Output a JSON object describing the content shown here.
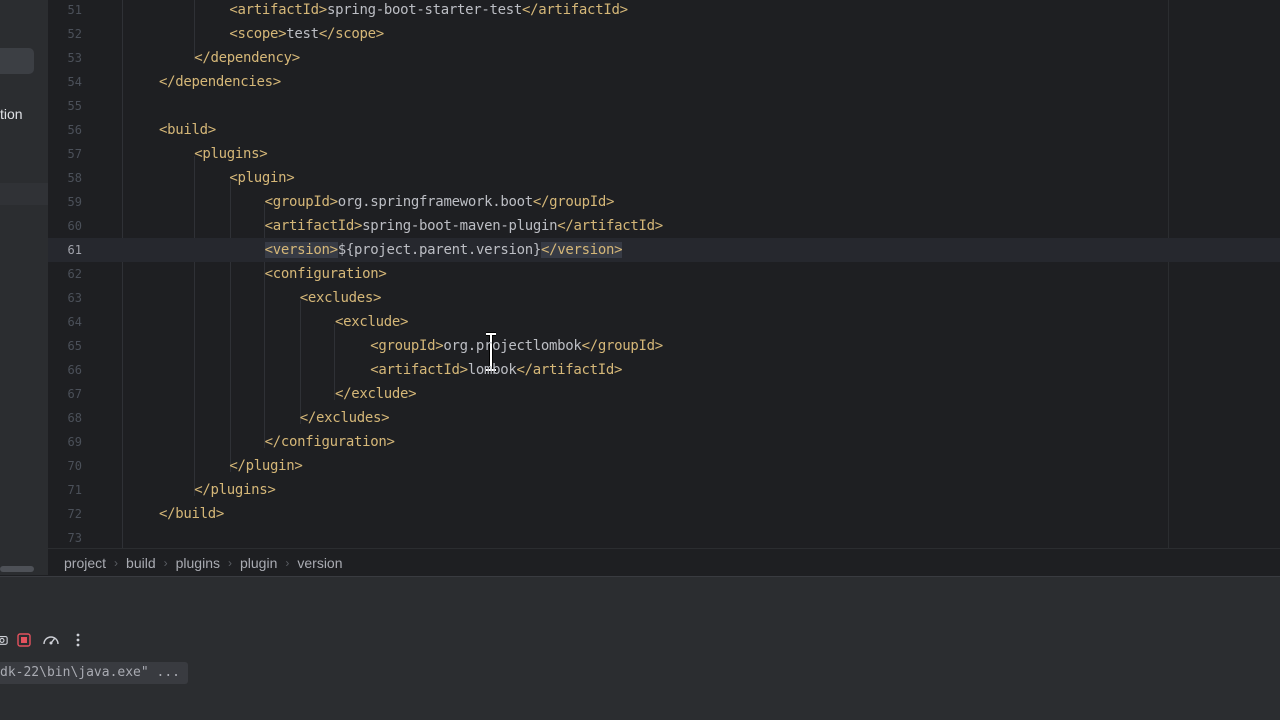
{
  "left_panel": {
    "partial_label": "tion"
  },
  "editor": {
    "lines": [
      {
        "num": "51",
        "indent": 2,
        "parts": [
          {
            "c": "tag",
            "t": "<artifactId>"
          },
          {
            "c": "txt",
            "t": "spring-boot-starter-test"
          },
          {
            "c": "tag",
            "t": "</artifactId>"
          }
        ]
      },
      {
        "num": "52",
        "indent": 2,
        "parts": [
          {
            "c": "tag",
            "t": "<scope>"
          },
          {
            "c": "txt",
            "t": "test"
          },
          {
            "c": "tag",
            "t": "</scope>"
          }
        ]
      },
      {
        "num": "53",
        "indent": 1,
        "parts": [
          {
            "c": "tag",
            "t": "</dependency>"
          }
        ]
      },
      {
        "num": "54",
        "indent": 0,
        "parts": [
          {
            "c": "tag",
            "t": "</dependencies>"
          }
        ]
      },
      {
        "num": "55",
        "indent": 0,
        "parts": []
      },
      {
        "num": "56",
        "indent": 0,
        "parts": [
          {
            "c": "tag",
            "t": "<build>"
          }
        ]
      },
      {
        "num": "57",
        "indent": 1,
        "parts": [
          {
            "c": "tag",
            "t": "<plugins>"
          }
        ]
      },
      {
        "num": "58",
        "indent": 2,
        "parts": [
          {
            "c": "tag",
            "t": "<plugin>"
          }
        ]
      },
      {
        "num": "59",
        "indent": 3,
        "parts": [
          {
            "c": "tag",
            "t": "<groupId>"
          },
          {
            "c": "txt",
            "t": "org.springframework.boot"
          },
          {
            "c": "tag",
            "t": "</groupId>"
          }
        ]
      },
      {
        "num": "60",
        "indent": 3,
        "parts": [
          {
            "c": "tag",
            "t": "<artifactId>"
          },
          {
            "c": "txt",
            "t": "spring-boot-maven-plugin"
          },
          {
            "c": "tag",
            "t": "</artifactId>"
          }
        ]
      },
      {
        "num": "61",
        "indent": 3,
        "current": true,
        "parts": [
          {
            "c": "tag sel",
            "t": "<version>"
          },
          {
            "c": "txt",
            "t": "${project.parent.version}"
          },
          {
            "c": "tag sel",
            "t": "</version>"
          }
        ]
      },
      {
        "num": "62",
        "indent": 3,
        "parts": [
          {
            "c": "tag",
            "t": "<configuration>"
          }
        ]
      },
      {
        "num": "63",
        "indent": 4,
        "parts": [
          {
            "c": "tag",
            "t": "<excludes>"
          }
        ]
      },
      {
        "num": "64",
        "indent": 5,
        "parts": [
          {
            "c": "tag",
            "t": "<exclude>"
          }
        ]
      },
      {
        "num": "65",
        "indent": 6,
        "parts": [
          {
            "c": "tag",
            "t": "<groupId>"
          },
          {
            "c": "txt",
            "t": "org.projectlombok"
          },
          {
            "c": "tag",
            "t": "</groupId>"
          }
        ]
      },
      {
        "num": "66",
        "indent": 6,
        "parts": [
          {
            "c": "tag",
            "t": "<artifactId>"
          },
          {
            "c": "txt",
            "t": "lombok"
          },
          {
            "c": "tag",
            "t": "</artifactId>"
          }
        ]
      },
      {
        "num": "67",
        "indent": 5,
        "parts": [
          {
            "c": "tag",
            "t": "</exclude>"
          }
        ]
      },
      {
        "num": "68",
        "indent": 4,
        "parts": [
          {
            "c": "tag",
            "t": "</excludes>"
          }
        ]
      },
      {
        "num": "69",
        "indent": 3,
        "parts": [
          {
            "c": "tag",
            "t": "</configuration>"
          }
        ]
      },
      {
        "num": "70",
        "indent": 2,
        "parts": [
          {
            "c": "tag",
            "t": "</plugin>"
          }
        ]
      },
      {
        "num": "71",
        "indent": 1,
        "parts": [
          {
            "c": "tag",
            "t": "</plugins>"
          }
        ]
      },
      {
        "num": "72",
        "indent": 0,
        "parts": [
          {
            "c": "tag",
            "t": "</build>"
          }
        ]
      },
      {
        "num": "73",
        "indent": 0,
        "parts": []
      }
    ]
  },
  "breadcrumb": [
    "project",
    "build",
    "plugins",
    "plugin",
    "version"
  ],
  "bottom_panel": {
    "toolbar_icons": [
      "camera-icon",
      "stop-icon",
      "speedometer-icon",
      "more-vertical-icon"
    ],
    "console_text": "dk-22\\bin\\java.exe\" ..."
  },
  "colors": {
    "background": "#1e1f22",
    "tag": "#d5b778",
    "text": "#bcbec4",
    "line_number": "#4b5059",
    "panel": "#2b2d30"
  }
}
